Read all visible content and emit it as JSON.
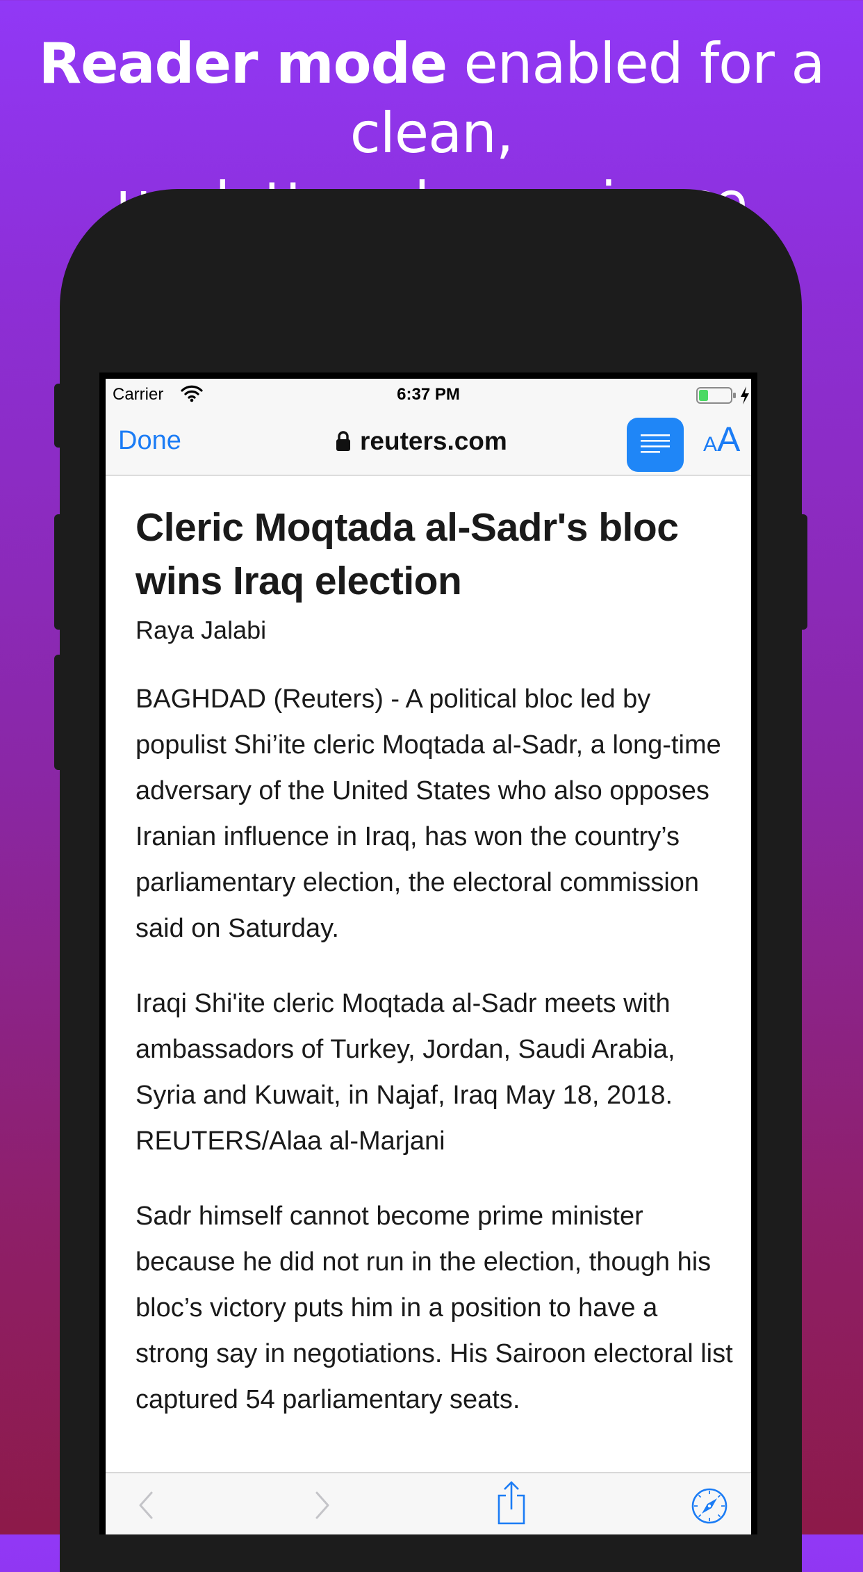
{
  "headline": {
    "bold_text": "Reader mode",
    "regular_text_line1": " enabled for a clean,",
    "regular_text_line2": "uncluttered experience"
  },
  "status_bar": {
    "carrier": "Carrier",
    "time": "6:37 PM",
    "battery_color": "#4cd964"
  },
  "nav": {
    "done_label": "Done",
    "url": "reuters.com",
    "text_size_small": "A",
    "text_size_large": "A",
    "accent_color": "#1b7cf5"
  },
  "article": {
    "title": "Cleric Moqtada al-Sadr's bloc wins Iraq election",
    "author": "Raya Jalabi",
    "paragraphs": [
      "BAGHDAD (Reuters) - A political bloc led by populist Shi’ite cleric Moqtada al-Sadr, a long-time adversary of the United States who also opposes Iranian influence in Iraq, has won the country’s parliamentary election, the electoral commission said on Saturday.",
      "Iraqi Shi'ite cleric Moqtada al-Sadr meets with ambassadors of Turkey, Jordan, Saudi Arabia, Syria and Kuwait, in Najaf, Iraq May 18, 2018. REUTERS/Alaa al-Marjani",
      "Sadr himself cannot become prime minister because he did not run in the election, though his bloc’s victory puts him in a position to have a strong say in negotiations. His Sairoon electoral list captured 54 parliamentary seats."
    ]
  },
  "toolbar": {
    "icons": [
      "back-icon",
      "forward-icon",
      "share-icon",
      "compass-icon"
    ]
  }
}
